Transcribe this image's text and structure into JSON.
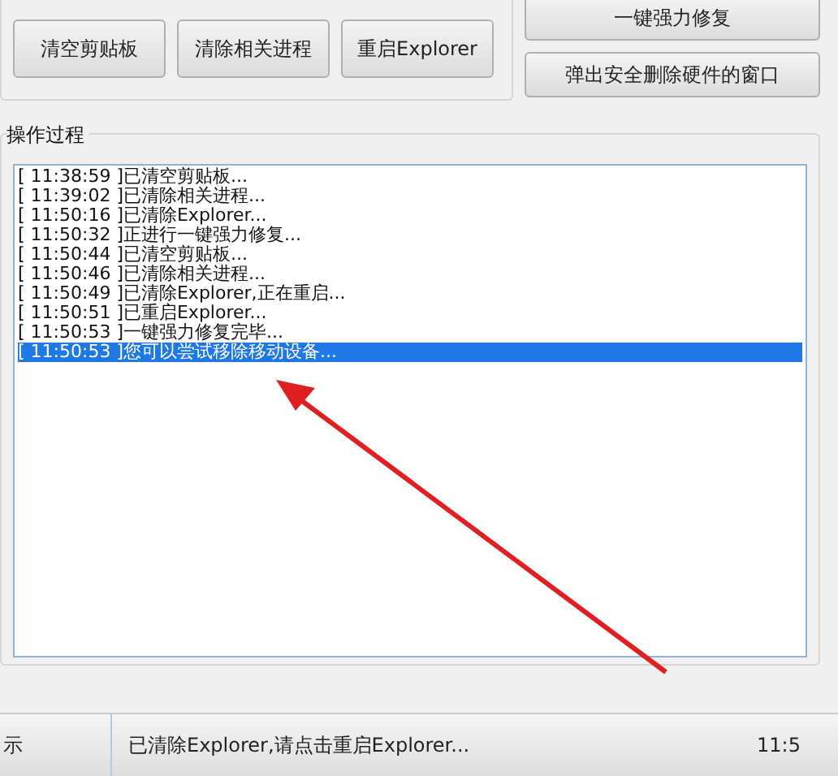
{
  "quick_actions": {
    "buttons": [
      "清空剪贴板",
      "清除相关进程",
      "重启Explorer"
    ]
  },
  "side_buttons": [
    "一键强力修复",
    "弹出安全删除硬件的窗口"
  ],
  "log": {
    "title": "操作过程",
    "entries": [
      {
        "time": "[ 11:38:59 ]",
        "message": "已清空剪贴板...",
        "selected": false
      },
      {
        "time": "[ 11:39:02 ]",
        "message": "已清除相关进程...",
        "selected": false
      },
      {
        "time": "[ 11:50:16 ]",
        "message": "已清除Explorer...",
        "selected": false
      },
      {
        "time": "[ 11:50:32 ]",
        "message": "正进行一键强力修复...",
        "selected": false
      },
      {
        "time": "[ 11:50:44 ]",
        "message": "已清空剪贴板...",
        "selected": false
      },
      {
        "time": "[ 11:50:46 ]",
        "message": "已清除相关进程...",
        "selected": false
      },
      {
        "time": "[ 11:50:49 ]",
        "message": "已清除Explorer,正在重启...",
        "selected": false
      },
      {
        "time": "[ 11:50:51 ]",
        "message": "已重启Explorer...",
        "selected": false
      },
      {
        "time": "[ 11:50:53 ]",
        "message": "一键强力修复完毕...",
        "selected": false
      },
      {
        "time": "[ 11:50:53 ]",
        "message": "您可以尝试移除移动设备...",
        "selected": true
      }
    ]
  },
  "status_bar": {
    "label": "示",
    "message": "已清除Explorer,请点击重启Explorer...",
    "time": "11:5"
  }
}
